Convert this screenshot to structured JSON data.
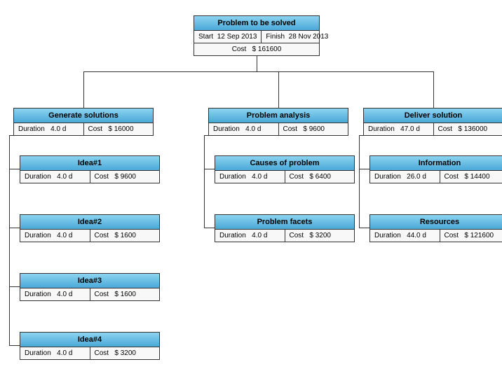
{
  "root": {
    "title": "Problem to be solved",
    "start_label": "Start",
    "start_value": "12 Sep 2013",
    "finish_label": "Finish",
    "finish_value": "28 Nov 2013",
    "cost_label": "Cost",
    "cost_value": "$ 161600"
  },
  "branches": [
    {
      "title": "Generate solutions",
      "duration_label": "Duration",
      "duration_value": "4.0 d",
      "cost_label": "Cost",
      "cost_value": "$ 16000",
      "children": [
        {
          "title": "Idea#1",
          "duration_label": "Duration",
          "duration_value": "4.0 d",
          "cost_label": "Cost",
          "cost_value": "$ 9600"
        },
        {
          "title": "Idea#2",
          "duration_label": "Duration",
          "duration_value": "4.0 d",
          "cost_label": "Cost",
          "cost_value": "$ 1600"
        },
        {
          "title": "Idea#3",
          "duration_label": "Duration",
          "duration_value": "4.0 d",
          "cost_label": "Cost",
          "cost_value": "$ 1600"
        },
        {
          "title": "Idea#4",
          "duration_label": "Duration",
          "duration_value": "4.0 d",
          "cost_label": "Cost",
          "cost_value": "$ 3200"
        }
      ]
    },
    {
      "title": "Problem analysis",
      "duration_label": "Duration",
      "duration_value": "4.0 d",
      "cost_label": "Cost",
      "cost_value": "$ 9600",
      "children": [
        {
          "title": "Causes of problem",
          "duration_label": "Duration",
          "duration_value": "4.0 d",
          "cost_label": "Cost",
          "cost_value": "$ 6400"
        },
        {
          "title": "Problem facets",
          "duration_label": "Duration",
          "duration_value": "4.0 d",
          "cost_label": "Cost",
          "cost_value": "$ 3200"
        }
      ]
    },
    {
      "title": "Deliver solution",
      "duration_label": "Duration",
      "duration_value": "47.0 d",
      "cost_label": "Cost",
      "cost_value": "$ 136000",
      "children": [
        {
          "title": "Information",
          "duration_label": "Duration",
          "duration_value": "26.0 d",
          "cost_label": "Cost",
          "cost_value": "$ 14400"
        },
        {
          "title": "Resources",
          "duration_label": "Duration",
          "duration_value": "44.0 d",
          "cost_label": "Cost",
          "cost_value": "$ 121600"
        }
      ]
    }
  ]
}
